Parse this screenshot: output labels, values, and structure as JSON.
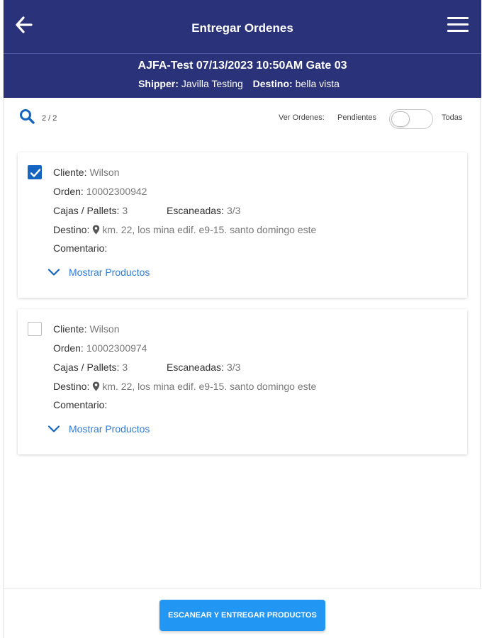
{
  "header": {
    "title": "Entregar Ordenes",
    "info_line": "AJFA-Test 07/13/2023 10:50AM Gate 03",
    "shipper_label": "Shipper:",
    "shipper_value": "Javilla Testing",
    "destino_label": "Destino:",
    "destino_value": "bella vista"
  },
  "filter": {
    "count": "2 / 2",
    "ver_ordenes_label": "Ver Ordenes:",
    "pendientes_label": "Pendientes",
    "todas_label": "Todas",
    "toggle_on": false
  },
  "orders": [
    {
      "checked": true,
      "cliente_label": "Cliente:",
      "cliente": "Wilson",
      "orden_label": "Orden:",
      "orden": "10002300942",
      "cajas_label": "Cajas / Pallets:",
      "cajas": "3",
      "escaneadas_label": "Escaneadas:",
      "escaneadas": "3/3",
      "destino_label": "Destino:",
      "destino": "km. 22, los mina edif. e9-15. santo domingo este",
      "comentario_label": "Comentario:",
      "show_products": "Mostrar Productos"
    },
    {
      "checked": false,
      "cliente_label": "Cliente:",
      "cliente": "Wilson",
      "orden_label": "Orden:",
      "orden": "10002300974",
      "cajas_label": "Cajas / Pallets:",
      "cajas": "3",
      "escaneadas_label": "Escaneadas:",
      "escaneadas": "3/3",
      "destino_label": "Destino:",
      "destino": "km. 22, los mina edif. e9-15. santo domingo este",
      "comentario_label": "Comentario:",
      "show_products": "Mostrar Productos"
    }
  ],
  "footer": {
    "scan_button": "ESCANEAR Y ENTREGAR PRODUCTOS"
  },
  "colors": {
    "header_bg": "#2a3279",
    "primary_button": "#2196f3",
    "link": "#2e7bd6",
    "checkbox_checked": "#1565c0"
  },
  "icons": [
    "back-arrow-icon",
    "hamburger-menu-icon",
    "search-icon",
    "map-pin-icon",
    "chevron-down-icon",
    "checkmark-icon"
  ]
}
